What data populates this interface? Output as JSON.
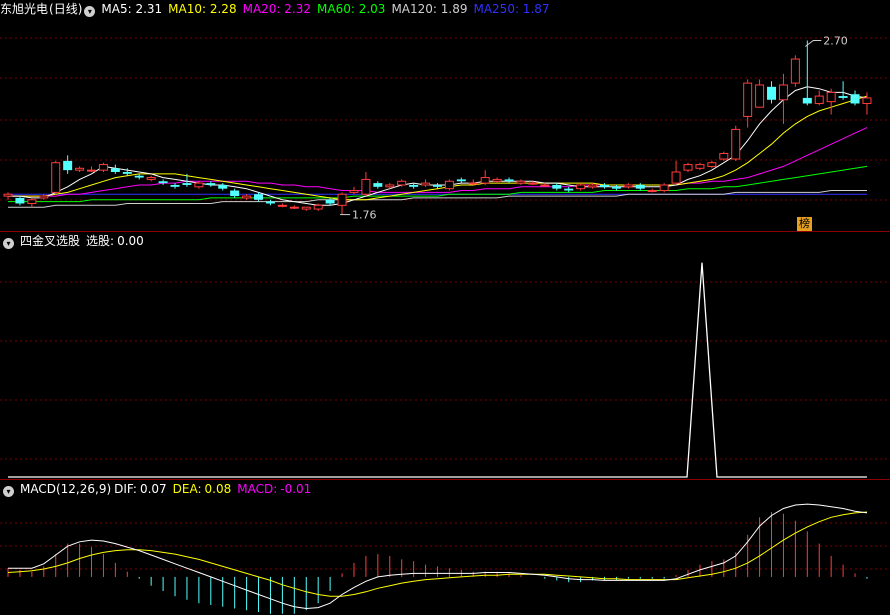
{
  "stock": {
    "name": "东旭光电",
    "period": "(日线)",
    "ma": [
      {
        "label": "MA5:",
        "value": "2.31",
        "color": "#ffffff"
      },
      {
        "label": "MA10:",
        "value": "2.28",
        "color": "#ffff00"
      },
      {
        "label": "MA20:",
        "value": "2.32",
        "color": "#ff00ff"
      },
      {
        "label": "MA60:",
        "value": "2.03",
        "color": "#00ff00"
      },
      {
        "label": "MA120:",
        "value": "1.89",
        "color": "#cfcfcf"
      },
      {
        "label": "MA250:",
        "value": "1.87",
        "color": "#3030ff"
      }
    ],
    "high_label": "2.70",
    "low_label": "1.76",
    "badge": "榜"
  },
  "indicator": {
    "name": "四金叉选股",
    "label": "选股:",
    "value": "0.00"
  },
  "macd": {
    "name": "MACD(12,26,9)",
    "dif_label": "DIF:",
    "dif": "0.07",
    "dea_label": "DEA:",
    "dea": "0.08",
    "macd_label": "MACD:",
    "macd": "-0.01"
  },
  "colors": {
    "up": "#ff3c3c",
    "down": "#54ffff",
    "grid": "#7a0000",
    "border": "#8b0000"
  },
  "chart_data": {
    "type": "candlestick",
    "candles": [
      [
        1.86,
        1.87,
        1.84,
        1.88
      ],
      [
        1.85,
        1.82,
        1.81,
        1.86
      ],
      [
        1.82,
        1.84,
        1.8,
        1.85
      ],
      [
        1.85,
        1.86,
        1.84,
        1.87
      ],
      [
        1.88,
        2.04,
        1.87,
        2.05
      ],
      [
        2.05,
        2.0,
        1.98,
        2.08
      ],
      [
        2.0,
        2.01,
        1.99,
        2.02
      ],
      [
        2.0,
        2.0,
        1.99,
        2.02
      ],
      [
        2.0,
        2.03,
        1.99,
        2.04
      ],
      [
        2.01,
        1.99,
        1.98,
        2.03
      ],
      [
        1.99,
        1.98,
        1.97,
        2.01
      ],
      [
        1.97,
        1.96,
        1.95,
        1.98
      ],
      [
        1.95,
        1.96,
        1.94,
        1.97
      ],
      [
        1.94,
        1.93,
        1.92,
        1.95
      ],
      [
        1.92,
        1.91,
        1.9,
        1.93
      ],
      [
        1.93,
        1.92,
        1.91,
        1.98
      ],
      [
        1.91,
        1.93,
        1.9,
        1.94
      ],
      [
        1.93,
        1.92,
        1.91,
        1.94
      ],
      [
        1.92,
        1.9,
        1.89,
        1.93
      ],
      [
        1.89,
        1.86,
        1.85,
        1.9
      ],
      [
        1.85,
        1.86,
        1.84,
        1.87
      ],
      [
        1.87,
        1.84,
        1.83,
        1.88
      ],
      [
        1.83,
        1.82,
        1.81,
        1.84
      ],
      [
        1.81,
        1.81,
        1.8,
        1.82
      ],
      [
        1.8,
        1.8,
        1.79,
        1.81
      ],
      [
        1.79,
        1.8,
        1.78,
        1.8
      ],
      [
        1.79,
        1.81,
        1.78,
        1.82
      ],
      [
        1.84,
        1.82,
        1.81,
        1.85
      ],
      [
        1.81,
        1.87,
        1.76,
        1.88
      ],
      [
        1.88,
        1.89,
        1.87,
        1.91
      ],
      [
        1.87,
        1.95,
        1.86,
        1.99
      ],
      [
        1.93,
        1.91,
        1.9,
        1.94
      ],
      [
        1.91,
        1.92,
        1.9,
        1.93
      ],
      [
        1.92,
        1.94,
        1.91,
        1.95
      ],
      [
        1.92,
        1.91,
        1.9,
        1.93
      ],
      [
        1.92,
        1.93,
        1.91,
        1.95
      ],
      [
        1.92,
        1.91,
        1.9,
        1.93
      ],
      [
        1.9,
        1.94,
        1.89,
        1.95
      ],
      [
        1.95,
        1.94,
        1.93,
        1.96
      ],
      [
        1.93,
        1.93,
        1.92,
        1.95
      ],
      [
        1.93,
        1.96,
        1.92,
        2.0
      ],
      [
        1.94,
        1.95,
        1.93,
        1.96
      ],
      [
        1.95,
        1.94,
        1.93,
        1.96
      ],
      [
        1.93,
        1.94,
        1.92,
        1.95
      ],
      [
        1.93,
        1.93,
        1.92,
        1.94
      ],
      [
        1.92,
        1.92,
        1.91,
        1.93
      ],
      [
        1.92,
        1.9,
        1.89,
        1.93
      ],
      [
        1.9,
        1.89,
        1.88,
        1.91
      ],
      [
        1.9,
        1.92,
        1.89,
        1.93
      ],
      [
        1.91,
        1.92,
        1.9,
        1.93
      ],
      [
        1.92,
        1.91,
        1.9,
        1.93
      ],
      [
        1.91,
        1.9,
        1.89,
        1.92
      ],
      [
        1.91,
        1.92,
        1.9,
        1.93
      ],
      [
        1.92,
        1.9,
        1.89,
        1.93
      ],
      [
        1.89,
        1.89,
        1.88,
        1.9
      ],
      [
        1.89,
        1.92,
        1.88,
        1.93
      ],
      [
        1.93,
        1.99,
        1.92,
        2.05
      ],
      [
        2.0,
        2.03,
        1.99,
        2.04
      ],
      [
        2.01,
        2.03,
        2.0,
        2.04
      ],
      [
        2.02,
        2.04,
        2.01,
        2.05
      ],
      [
        2.06,
        2.09,
        2.05,
        2.1
      ],
      [
        2.06,
        2.22,
        2.05,
        2.24
      ],
      [
        2.29,
        2.47,
        2.23,
        2.49
      ],
      [
        2.34,
        2.46,
        2.34,
        2.49
      ],
      [
        2.45,
        2.38,
        2.36,
        2.48
      ],
      [
        2.38,
        2.46,
        2.25,
        2.52
      ],
      [
        2.47,
        2.6,
        2.45,
        2.62
      ],
      [
        2.39,
        2.36,
        2.35,
        2.7
      ],
      [
        2.36,
        2.4,
        2.35,
        2.43
      ],
      [
        2.37,
        2.42,
        2.3,
        2.44
      ],
      [
        2.4,
        2.39,
        2.38,
        2.48
      ],
      [
        2.41,
        2.36,
        2.35,
        2.43
      ],
      [
        2.36,
        2.39,
        2.3,
        2.42
      ]
    ],
    "ma5": [
      1.86,
      1.86,
      1.85,
      1.85,
      1.88,
      1.91,
      1.95,
      1.98,
      2.02,
      2.01,
      2.0,
      1.99,
      1.98,
      1.96,
      1.95,
      1.94,
      1.93,
      1.92,
      1.92,
      1.91,
      1.9,
      1.88,
      1.86,
      1.84,
      1.83,
      1.82,
      1.81,
      1.81,
      1.82,
      1.84,
      1.86,
      1.88,
      1.9,
      1.92,
      1.93,
      1.92,
      1.92,
      1.92,
      1.93,
      1.93,
      1.94,
      1.94,
      1.94,
      1.94,
      1.94,
      1.93,
      1.93,
      1.92,
      1.91,
      1.91,
      1.91,
      1.91,
      1.91,
      1.91,
      1.91,
      1.91,
      1.92,
      1.95,
      1.97,
      2.0,
      2.04,
      2.08,
      2.16,
      2.25,
      2.32,
      2.38,
      2.43,
      2.45,
      2.44,
      2.42,
      2.42,
      2.4,
      2.39
    ],
    "ma10": [
      1.86,
      1.86,
      1.86,
      1.86,
      1.87,
      1.88,
      1.9,
      1.92,
      1.94,
      1.96,
      1.97,
      1.98,
      1.98,
      1.98,
      1.98,
      1.97,
      1.96,
      1.95,
      1.94,
      1.93,
      1.92,
      1.91,
      1.9,
      1.89,
      1.88,
      1.87,
      1.86,
      1.85,
      1.84,
      1.84,
      1.84,
      1.85,
      1.86,
      1.87,
      1.88,
      1.89,
      1.9,
      1.91,
      1.92,
      1.92,
      1.93,
      1.93,
      1.93,
      1.93,
      1.93,
      1.93,
      1.93,
      1.93,
      1.93,
      1.93,
      1.92,
      1.92,
      1.92,
      1.92,
      1.92,
      1.92,
      1.92,
      1.93,
      1.94,
      1.95,
      1.97,
      2.0,
      2.04,
      2.09,
      2.14,
      2.2,
      2.25,
      2.29,
      2.32,
      2.34,
      2.36,
      2.38,
      2.4
    ],
    "ma20": [
      1.86,
      1.86,
      1.86,
      1.86,
      1.86,
      1.87,
      1.87,
      1.88,
      1.89,
      1.9,
      1.91,
      1.92,
      1.92,
      1.93,
      1.93,
      1.94,
      1.94,
      1.94,
      1.94,
      1.94,
      1.94,
      1.93,
      1.93,
      1.92,
      1.92,
      1.91,
      1.91,
      1.9,
      1.89,
      1.89,
      1.89,
      1.88,
      1.88,
      1.88,
      1.88,
      1.88,
      1.88,
      1.88,
      1.89,
      1.89,
      1.9,
      1.9,
      1.9,
      1.91,
      1.91,
      1.91,
      1.91,
      1.91,
      1.92,
      1.92,
      1.92,
      1.92,
      1.92,
      1.92,
      1.92,
      1.92,
      1.92,
      1.93,
      1.93,
      1.94,
      1.94,
      1.95,
      1.96,
      1.98,
      2.0,
      2.02,
      2.05,
      2.08,
      2.11,
      2.14,
      2.17,
      2.2,
      2.23
    ],
    "ma60": [
      1.83,
      1.83,
      1.83,
      1.83,
      1.83,
      1.83,
      1.83,
      1.84,
      1.84,
      1.84,
      1.84,
      1.84,
      1.84,
      1.84,
      1.84,
      1.84,
      1.84,
      1.85,
      1.85,
      1.85,
      1.85,
      1.85,
      1.85,
      1.85,
      1.85,
      1.85,
      1.85,
      1.85,
      1.85,
      1.86,
      1.86,
      1.86,
      1.86,
      1.86,
      1.86,
      1.86,
      1.86,
      1.87,
      1.87,
      1.87,
      1.87,
      1.87,
      1.87,
      1.88,
      1.88,
      1.88,
      1.88,
      1.88,
      1.88,
      1.88,
      1.89,
      1.89,
      1.89,
      1.89,
      1.89,
      1.89,
      1.89,
      1.9,
      1.9,
      1.9,
      1.91,
      1.91,
      1.92,
      1.93,
      1.94,
      1.95,
      1.96,
      1.97,
      1.98,
      1.99,
      2.0,
      2.01,
      2.02
    ],
    "ma120": [
      1.8,
      1.8,
      1.8,
      1.8,
      1.81,
      1.81,
      1.81,
      1.81,
      1.81,
      1.81,
      1.82,
      1.82,
      1.82,
      1.82,
      1.82,
      1.82,
      1.82,
      1.82,
      1.83,
      1.83,
      1.83,
      1.83,
      1.83,
      1.83,
      1.83,
      1.83,
      1.84,
      1.84,
      1.84,
      1.84,
      1.84,
      1.84,
      1.84,
      1.84,
      1.85,
      1.85,
      1.85,
      1.85,
      1.85,
      1.85,
      1.85,
      1.85,
      1.86,
      1.86,
      1.86,
      1.86,
      1.86,
      1.86,
      1.86,
      1.86,
      1.86,
      1.86,
      1.87,
      1.87,
      1.87,
      1.87,
      1.87,
      1.87,
      1.87,
      1.87,
      1.87,
      1.88,
      1.88,
      1.88,
      1.88,
      1.88,
      1.88,
      1.88,
      1.88,
      1.89,
      1.89,
      1.89,
      1.89
    ],
    "ma250": [
      1.87,
      1.87,
      1.87,
      1.87,
      1.87,
      1.87,
      1.87,
      1.87,
      1.87,
      1.87,
      1.87,
      1.87,
      1.87,
      1.87,
      1.87,
      1.87,
      1.87,
      1.87,
      1.87,
      1.87,
      1.87,
      1.87,
      1.87,
      1.87,
      1.87,
      1.87,
      1.87,
      1.87,
      1.87,
      1.87,
      1.87,
      1.87,
      1.87,
      1.87,
      1.87,
      1.87,
      1.87,
      1.87,
      1.87,
      1.87,
      1.87,
      1.87,
      1.87,
      1.87,
      1.87,
      1.87,
      1.87,
      1.87,
      1.87,
      1.87,
      1.87,
      1.87,
      1.87,
      1.87,
      1.87,
      1.87,
      1.87,
      1.87,
      1.87,
      1.87,
      1.87,
      1.87,
      1.87,
      1.87,
      1.87,
      1.87,
      1.87,
      1.87,
      1.87,
      1.87,
      1.87,
      1.87,
      1.87
    ],
    "price_ylim": [
      1.72,
      2.8
    ],
    "signal": [
      0,
      0,
      0,
      0,
      0,
      0,
      0,
      0,
      0,
      0,
      0,
      0,
      0,
      0,
      0,
      0,
      0,
      0,
      0,
      0,
      0,
      0,
      0,
      0,
      0,
      0,
      0,
      0,
      0,
      0,
      0,
      0,
      0,
      0,
      0,
      0,
      0,
      0,
      0,
      0,
      0,
      0,
      0,
      0,
      0,
      0,
      0,
      0,
      0,
      0,
      0,
      0,
      0,
      0,
      0,
      0,
      0,
      0,
      0,
      0,
      0,
      0,
      0,
      0,
      0,
      0,
      0,
      0,
      0,
      0,
      0,
      0,
      0
    ],
    "signal_peak_index": 58,
    "signal_ylim": [
      0,
      1.05
    ],
    "dif": [
      0.01,
      0.01,
      0.01,
      0.015,
      0.025,
      0.035,
      0.04,
      0.042,
      0.041,
      0.038,
      0.034,
      0.03,
      0.025,
      0.02,
      0.015,
      0.01,
      0.005,
      0.0,
      -0.005,
      -0.01,
      -0.015,
      -0.02,
      -0.025,
      -0.03,
      -0.034,
      -0.036,
      -0.035,
      -0.03,
      -0.02,
      -0.012,
      -0.005,
      0.0,
      0.002,
      0.003,
      0.004,
      0.004,
      0.004,
      0.004,
      0.004,
      0.004,
      0.005,
      0.005,
      0.005,
      0.004,
      0.003,
      0.002,
      0.0,
      -0.002,
      -0.003,
      -0.003,
      -0.004,
      -0.004,
      -0.004,
      -0.004,
      -0.004,
      -0.004,
      -0.002,
      0.003,
      0.008,
      0.012,
      0.016,
      0.024,
      0.04,
      0.058,
      0.07,
      0.078,
      0.082,
      0.083,
      0.082,
      0.08,
      0.078,
      0.075,
      0.073
    ],
    "dea": [
      0.005,
      0.006,
      0.007,
      0.009,
      0.012,
      0.016,
      0.021,
      0.025,
      0.028,
      0.03,
      0.031,
      0.031,
      0.03,
      0.028,
      0.026,
      0.023,
      0.02,
      0.016,
      0.012,
      0.008,
      0.004,
      0.0,
      -0.004,
      -0.009,
      -0.013,
      -0.017,
      -0.02,
      -0.022,
      -0.022,
      -0.02,
      -0.017,
      -0.013,
      -0.01,
      -0.007,
      -0.005,
      -0.003,
      -0.002,
      -0.001,
      0.0,
      0.001,
      0.002,
      0.002,
      0.003,
      0.003,
      0.003,
      0.003,
      0.002,
      0.001,
      0.0,
      -0.001,
      -0.002,
      -0.002,
      -0.003,
      -0.003,
      -0.003,
      -0.003,
      -0.003,
      -0.001,
      0.001,
      0.003,
      0.006,
      0.01,
      0.016,
      0.024,
      0.033,
      0.042,
      0.05,
      0.057,
      0.063,
      0.068,
      0.071,
      0.073,
      0.074
    ],
    "macd_ylim": [
      -0.04,
      0.09
    ]
  }
}
